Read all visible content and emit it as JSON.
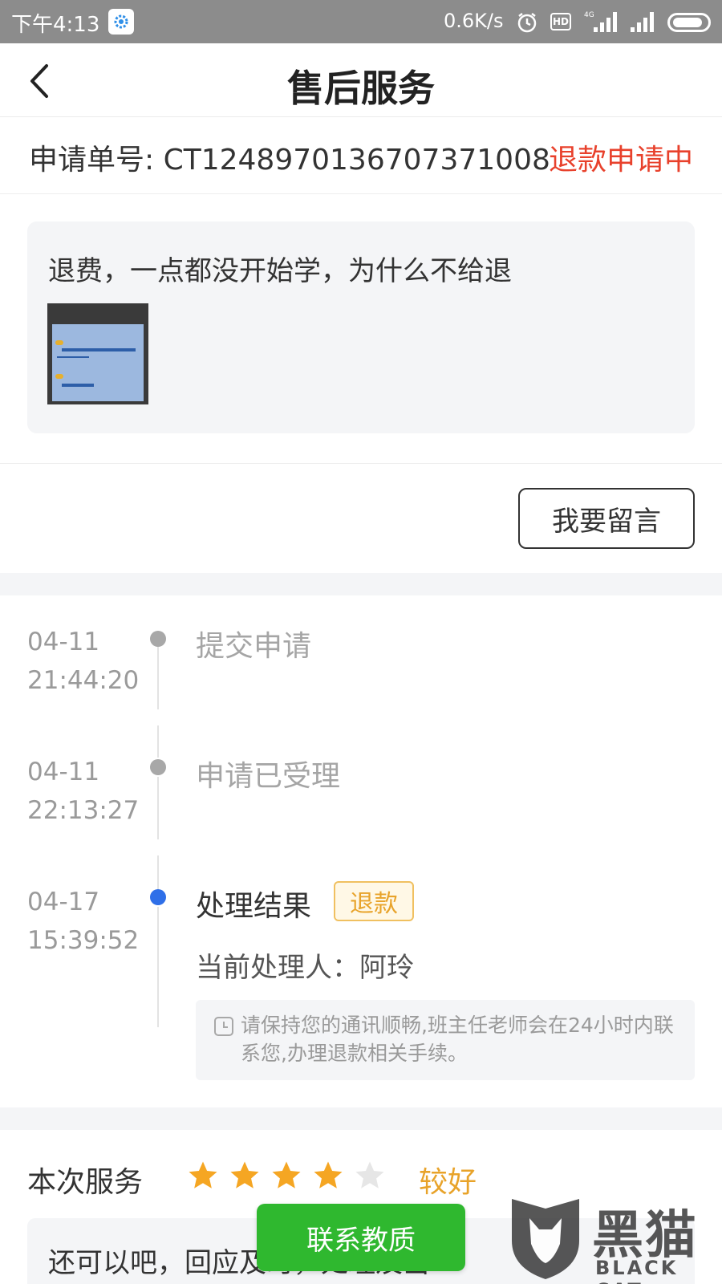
{
  "status_bar": {
    "time": "下午4:13",
    "network_speed": "0.6K/s",
    "hd_label": "HD",
    "icons": [
      "app-icon",
      "alarm-icon",
      "hd-icon",
      "signal-4g-icon",
      "signal-icon",
      "battery-icon"
    ]
  },
  "header": {
    "title": "售后服务",
    "back_icon": "back-arrow-icon"
  },
  "order": {
    "number_label": "申请单号: CT1248970136707371008",
    "status": "退款申请中",
    "status_color": "#e8412c"
  },
  "message": {
    "text": "退费，一点都没开始学，为什么不给退",
    "thumbnail": "attached-screenshot-thumbnail"
  },
  "leave_message_button": "我要留言",
  "timeline": [
    {
      "date": "04-11",
      "time": "21:44:20",
      "title": "提交申请",
      "active": false
    },
    {
      "date": "04-11",
      "time": "22:13:27",
      "title": "申请已受理",
      "active": false
    },
    {
      "date": "04-17",
      "time": "15:39:52",
      "title": "处理结果",
      "tag": "退款",
      "active": true,
      "handler": "当前处理人：阿玲",
      "notice": "请保持您的通讯顺畅,班主任老师会在24小时内联系您,办理退款相关手续。"
    }
  ],
  "rating": {
    "label": "本次服务",
    "stars_filled": 4,
    "stars_total": 5,
    "grade": "较好",
    "comment": "还可以吧，回应及时，处理及当"
  },
  "contact_button": "联系教质",
  "watermark": {
    "main": "黑猫",
    "sub": "BLACK CAT"
  },
  "colors": {
    "accent_blue": "#2f6fe8",
    "warning_orange": "#e8a32a",
    "contact_green": "#2fb82f",
    "star_gold": "#f5a623",
    "star_gray": "#e6e6e6"
  }
}
